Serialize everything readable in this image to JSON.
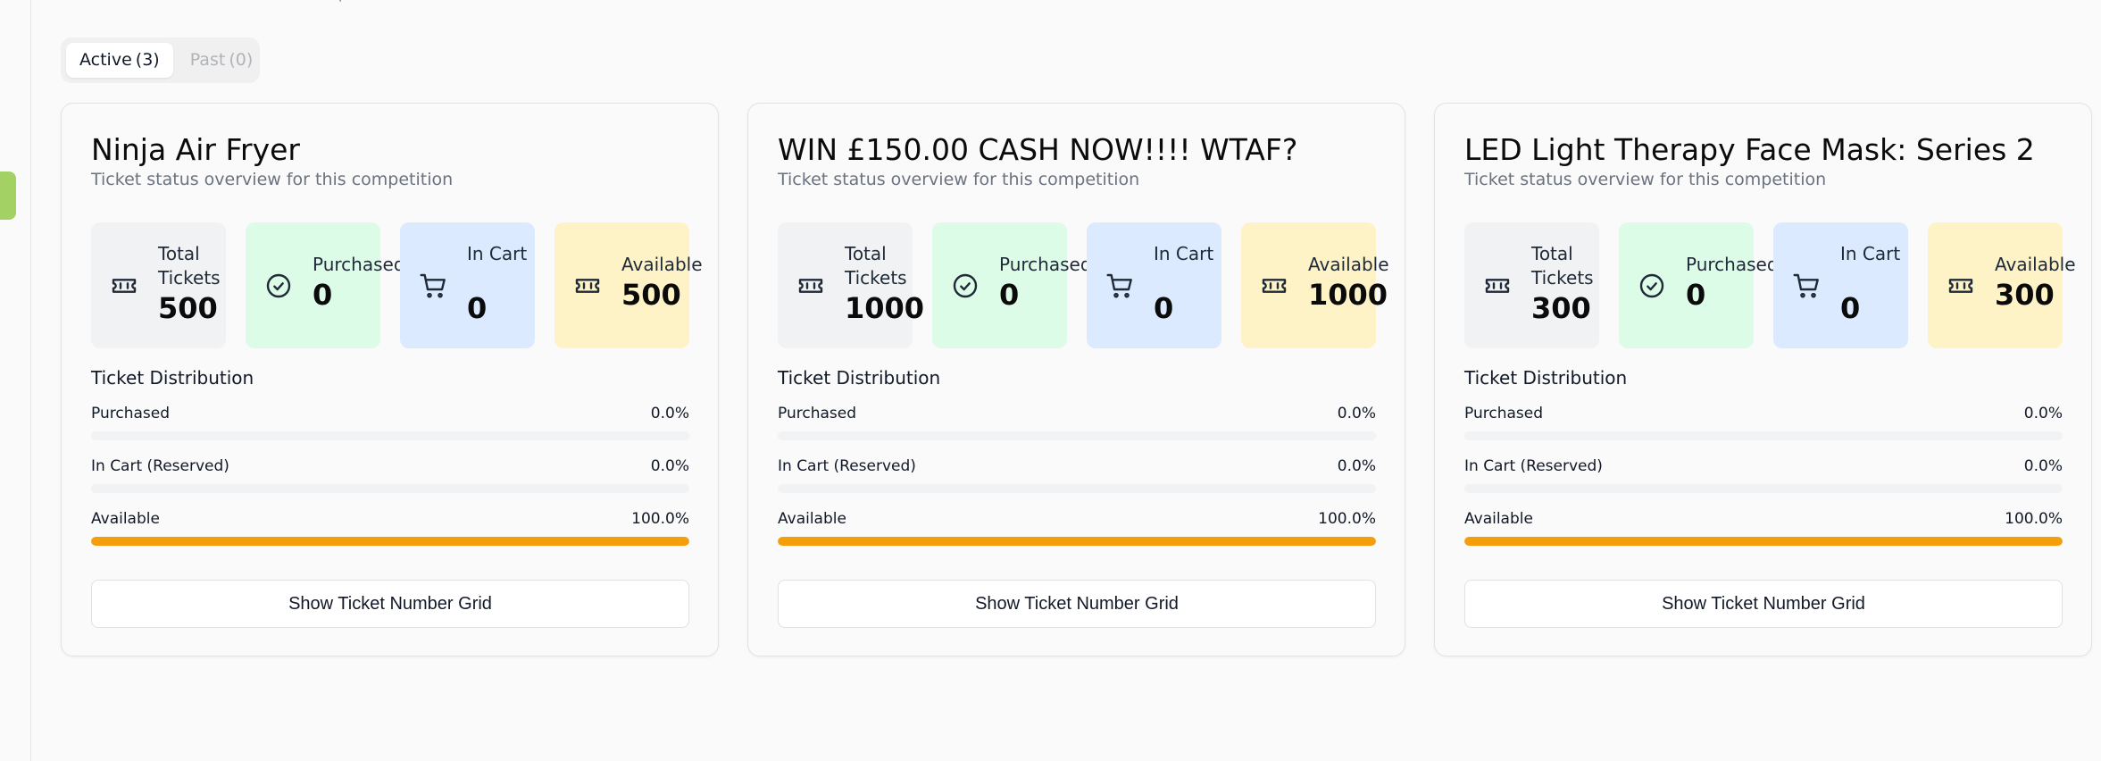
{
  "tabs": [
    {
      "label": "Active",
      "count": "(3)"
    },
    {
      "label": "Past",
      "count": "(0)"
    }
  ],
  "colors": {
    "accent_sidebar": "#a3d163",
    "available_bar": "#f59e0b",
    "purchased_tile": "#dcfce7",
    "incart_tile": "#dbeafe",
    "available_tile": "#fef3c7",
    "total_tile": "#f1f2f4"
  },
  "cards": [
    {
      "title": "Ninja Air Fryer",
      "subtitle": "Ticket status overview for this competition",
      "stats": {
        "total": {
          "label": "Total Tickets",
          "value": "500",
          "icon": "ticket-icon"
        },
        "purchased": {
          "label": "Purchased",
          "value": "0",
          "icon": "check-circle-icon"
        },
        "in_cart": {
          "label": "In Cart",
          "value": "0",
          "icon": "cart-icon"
        },
        "available": {
          "label": "Available",
          "value": "500",
          "icon": "ticket-icon"
        }
      },
      "distribution_heading": "Ticket Distribution",
      "distribution": [
        {
          "name": "Purchased",
          "pct": "0.0%",
          "fraction": 0.0
        },
        {
          "name": "In Cart (Reserved)",
          "pct": "0.0%",
          "fraction": 0.0
        },
        {
          "name": "Available",
          "pct": "100.0%",
          "fraction": 1.0
        }
      ],
      "button_label": "Show Ticket Number Grid"
    },
    {
      "title": "WIN £150.00 CASH NOW!!!! WTAF?",
      "subtitle": "Ticket status overview for this competition",
      "stats": {
        "total": {
          "label": "Total Tickets",
          "value": "1000",
          "icon": "ticket-icon"
        },
        "purchased": {
          "label": "Purchased",
          "value": "0",
          "icon": "check-circle-icon"
        },
        "in_cart": {
          "label": "In Cart",
          "value": "0",
          "icon": "cart-icon"
        },
        "available": {
          "label": "Available",
          "value": "1000",
          "icon": "ticket-icon"
        }
      },
      "distribution_heading": "Ticket Distribution",
      "distribution": [
        {
          "name": "Purchased",
          "pct": "0.0%",
          "fraction": 0.0
        },
        {
          "name": "In Cart (Reserved)",
          "pct": "0.0%",
          "fraction": 0.0
        },
        {
          "name": "Available",
          "pct": "100.0%",
          "fraction": 1.0
        }
      ],
      "button_label": "Show Ticket Number Grid"
    },
    {
      "title": "LED Light Therapy Face Mask: Series 2",
      "subtitle": "Ticket status overview for this competition",
      "stats": {
        "total": {
          "label": "Total Tickets",
          "value": "300",
          "icon": "ticket-icon"
        },
        "purchased": {
          "label": "Purchased",
          "value": "0",
          "icon": "check-circle-icon"
        },
        "in_cart": {
          "label": "In Cart",
          "value": "0",
          "icon": "cart-icon"
        },
        "available": {
          "label": "Available",
          "value": "300",
          "icon": "ticket-icon"
        }
      },
      "distribution_heading": "Ticket Distribution",
      "distribution": [
        {
          "name": "Purchased",
          "pct": "0.0%",
          "fraction": 0.0
        },
        {
          "name": "In Cart (Reserved)",
          "pct": "0.0%",
          "fraction": 0.0
        },
        {
          "name": "Available",
          "pct": "100.0%",
          "fraction": 1.0
        }
      ],
      "button_label": "Show Ticket Number Grid"
    }
  ]
}
